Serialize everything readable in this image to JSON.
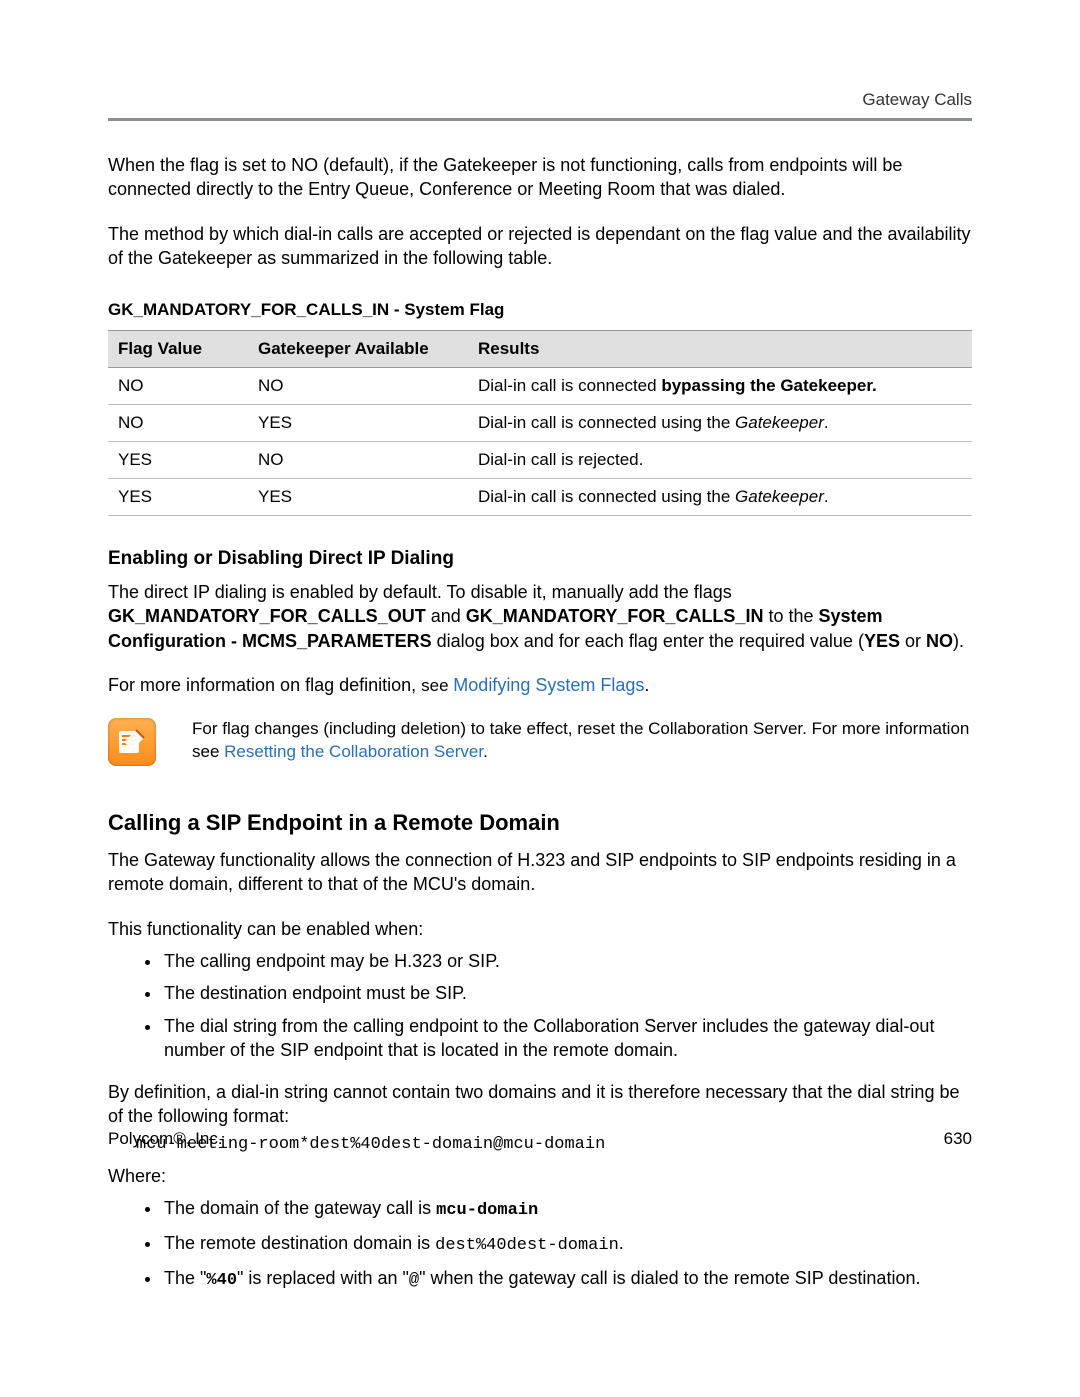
{
  "header": {
    "breadcrumb": "Gateway Calls"
  },
  "intro": {
    "para1": "When the flag is set to NO (default), if the Gatekeeper is not functioning, calls from endpoints will be connected directly to the Entry Queue, Conference or Meeting Room that was dialed.",
    "para2": "The method by which dial-in calls are accepted or rejected is dependant on the flag value and the availability of the Gatekeeper as summarized in the following table."
  },
  "table": {
    "caption": "GK_MANDATORY_FOR_CALLS_IN - System Flag",
    "headers": {
      "c1": "Flag Value",
      "c2": "Gatekeeper Available",
      "c3": "Results"
    },
    "rows": [
      {
        "c1": "NO",
        "c2": "NO",
        "c3_pre": "Dial-in call is connected ",
        "c3_b": "bypassing the Gatekeeper."
      },
      {
        "c1": "NO",
        "c2": "YES",
        "c3_pre": "Dial-in call is connected using the ",
        "c3_i": "Gatekeeper",
        "c3_post": "."
      },
      {
        "c1": "YES",
        "c2": "NO",
        "c3_pre": "Dial-in call is rejected."
      },
      {
        "c1": "YES",
        "c2": "YES",
        "c3_pre": "Dial-in call is connected using the ",
        "c3_i": "Gatekeeper",
        "c3_post": "."
      }
    ]
  },
  "sectionA": {
    "heading": "Enabling or Disabling Direct IP Dialing",
    "para1_a": "The direct IP dialing is enabled by default. To disable it, manually add the flags ",
    "para1_b1": "GK_MANDATORY_FOR_CALLS_OUT",
    "para1_b2": " and ",
    "para1_b3": "GK_MANDATORY_FOR_CALLS_IN",
    "para1_b4": " to the ",
    "para1_b5": "System Configuration - MCMS_PARAMETERS",
    "para1_b6": " dialog box and for each flag enter the required value (",
    "para1_b7": "YES",
    "para1_b8": " or ",
    "para1_b9": "NO",
    "para1_b10": ").",
    "para2_a": "For more information on flag definition, ",
    "para2_b": "see ",
    "para2_link": "Modifying System Flags",
    "para2_c": ".",
    "note_a": "For flag changes (including deletion) to take effect, reset the Collaboration Server. For more information see ",
    "note_link": "Resetting the Collaboration Server",
    "note_b": "."
  },
  "sectionB": {
    "heading": "Calling a SIP Endpoint in a Remote Domain",
    "para1": "The Gateway functionality allows the connection of H.323 and SIP endpoints to SIP endpoints residing in a remote domain, different to that of the MCU's domain.",
    "para2": "This functionality can be enabled when:",
    "bulletsA": [
      "The calling endpoint may be H.323 or SIP.",
      "The destination endpoint must be SIP.",
      "The dial string from the calling endpoint to the Collaboration Server includes the gateway dial-out number of the SIP endpoint that is located in the remote domain."
    ],
    "para3": "By definition, a dial-in string cannot contain two domains and it is therefore necessary that the dial string be of the following format:",
    "code": "mcu-meeting-room*dest%40dest-domain@mcu-domain",
    "para4": "Where:",
    "bulletsB": {
      "b1_a": "The domain of the gateway call is ",
      "b1_code": "mcu-domain",
      "b2_a": "The remote destination domain is ",
      "b2_code": "dest%40dest-domain",
      "b2_b": ".",
      "b3_a": "The \"",
      "b3_code1": "%40",
      "b3_b": "\" is replaced with an \"",
      "b3_code2": "@",
      "b3_c": "\" when the gateway call is dialed to the remote SIP destination."
    }
  },
  "footer": {
    "left_a": "Polycom",
    "left_b": ", Inc.",
    "right": "630"
  }
}
